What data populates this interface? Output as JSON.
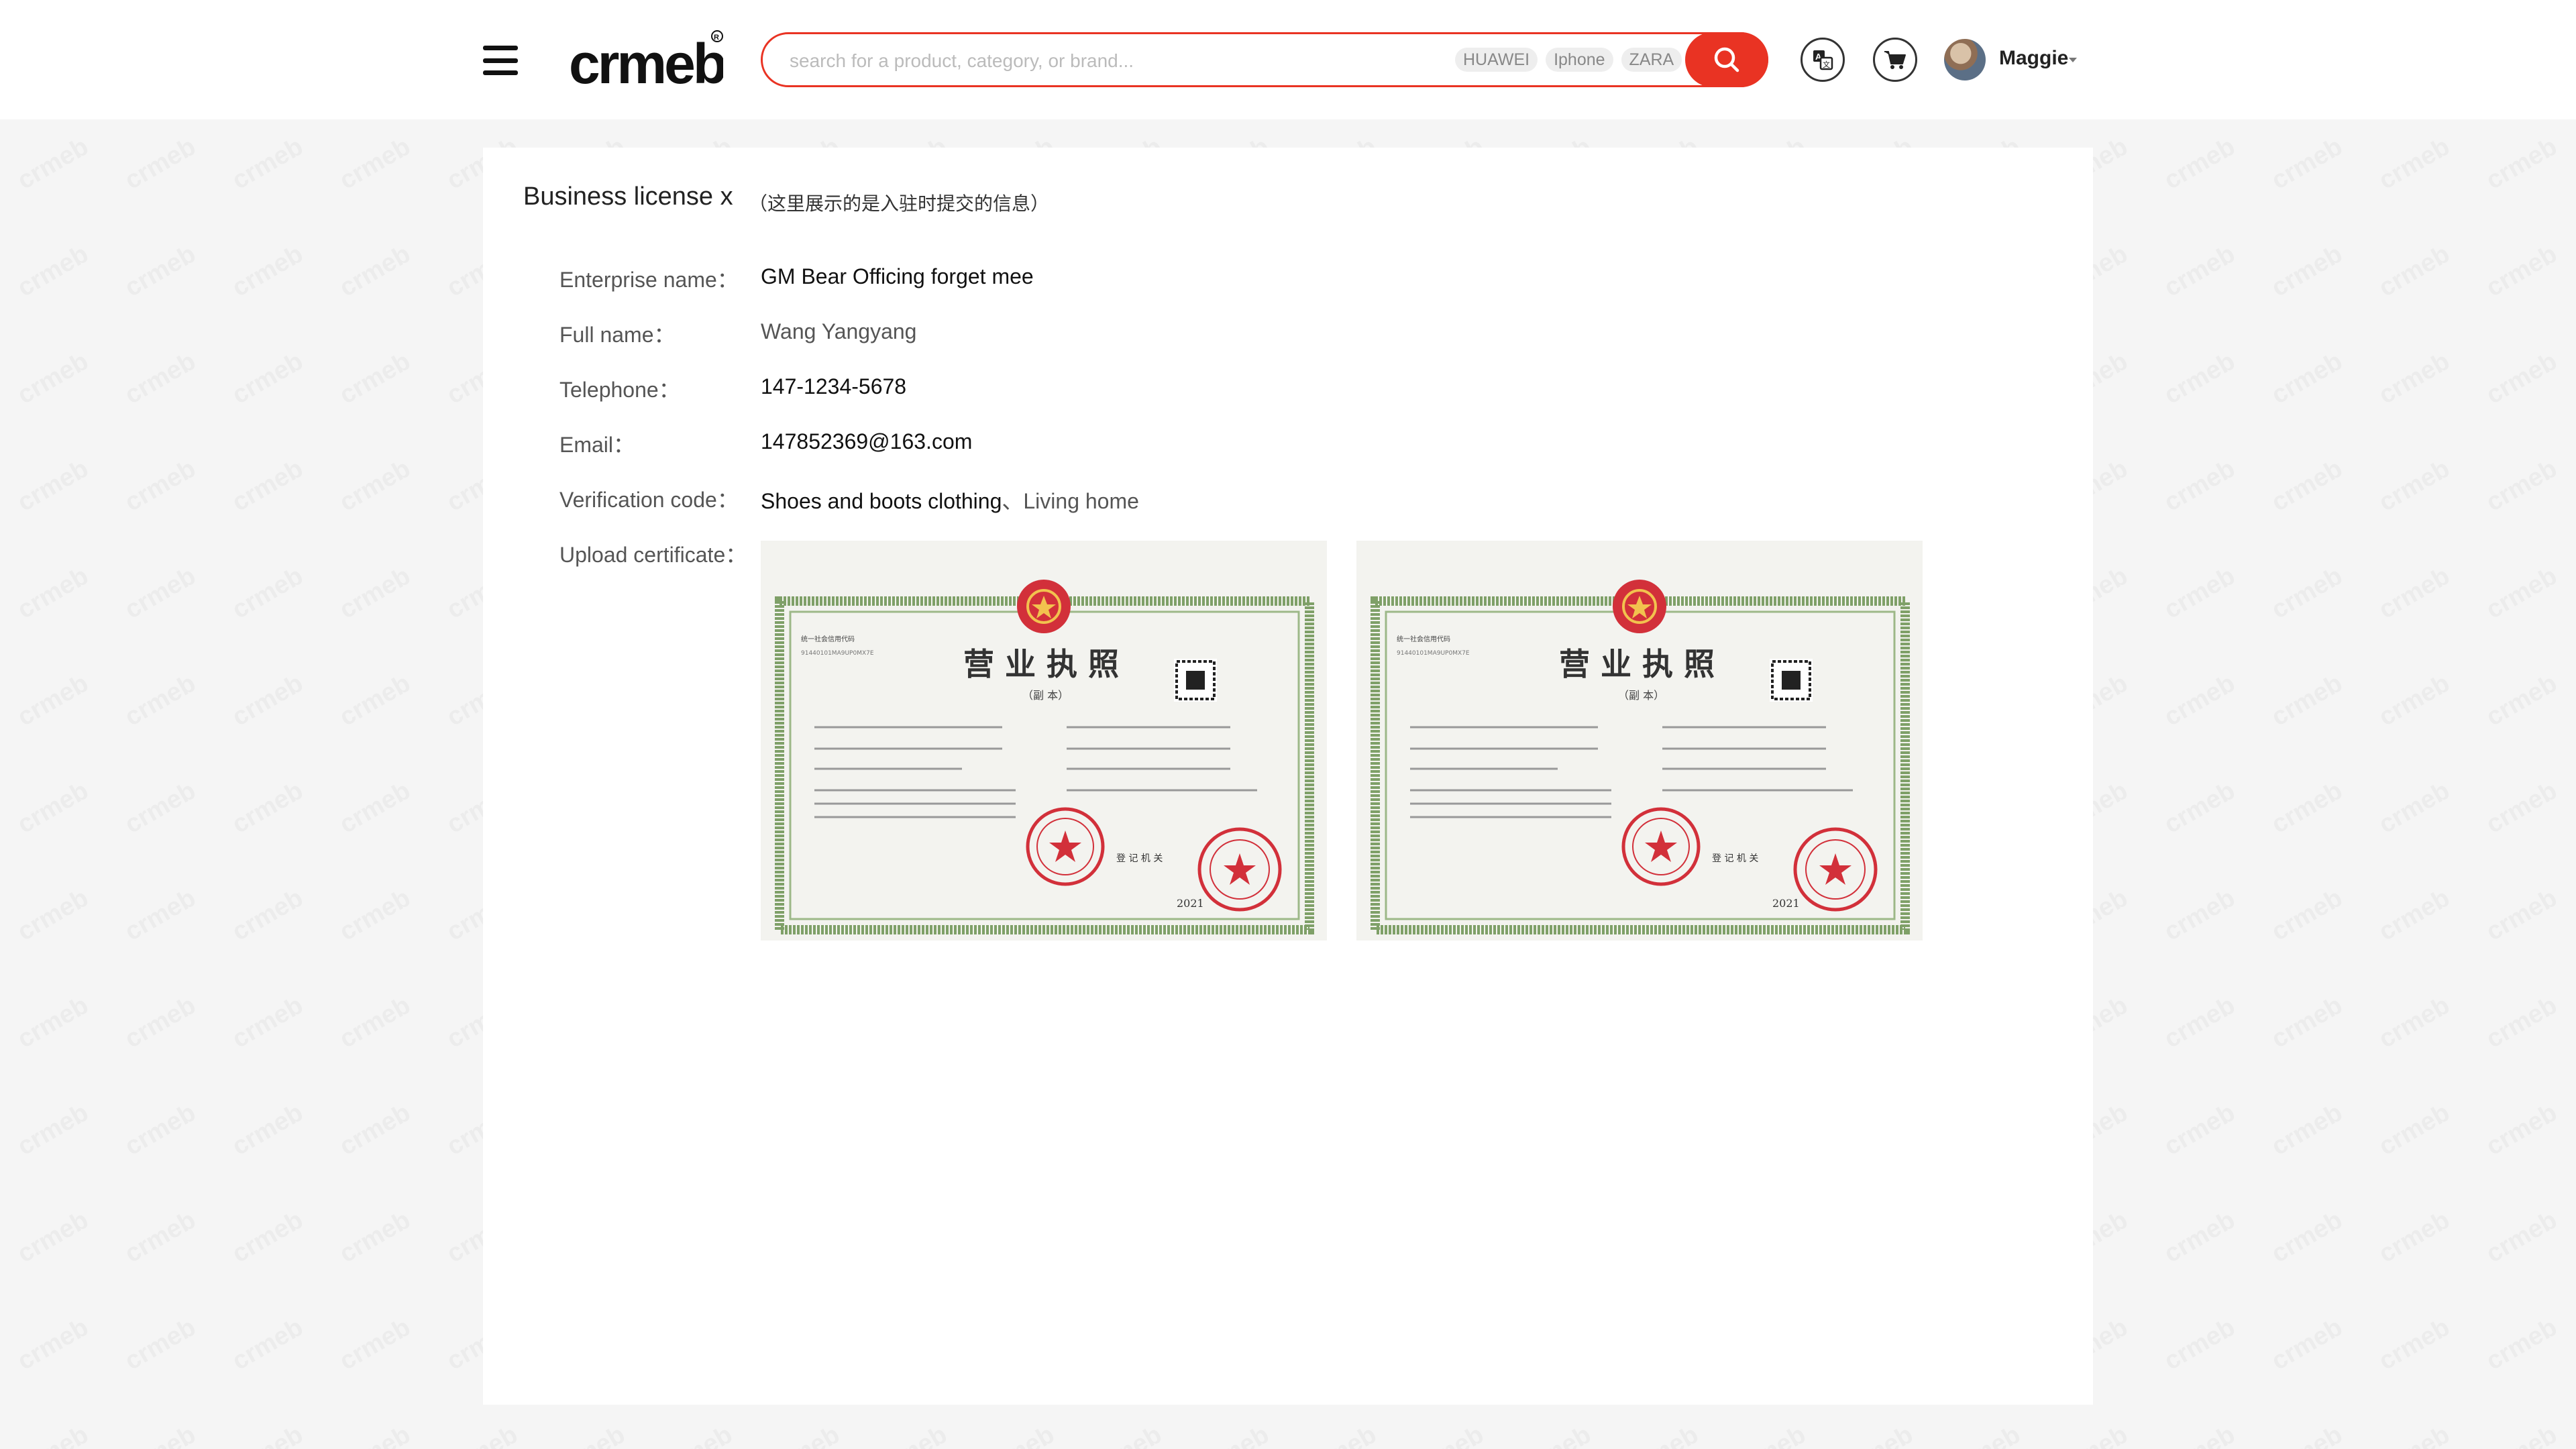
{
  "header": {
    "search_placeholder": "search for a product, category, or brand...",
    "hot_tags": [
      "HUAWEI",
      "Iphone",
      "ZARA"
    ],
    "user_name": "Maggie",
    "logo_text": "crmeb"
  },
  "page": {
    "title": "Business license x",
    "title_note": "（这里展示的是入驻时提交的信息）"
  },
  "fields": {
    "enterprise_label": "Enterprise name：",
    "enterprise_value": "GM Bear Officing forget mee",
    "fullname_label": "Full name：",
    "fullname_value": "Wang Yangyang",
    "telephone_label": "Telephone：",
    "telephone_value": "147-1234-5678",
    "email_label": "Email：",
    "email_value": "147852369@163.com",
    "verification_label": "Verification code：",
    "verification_value_1": "Shoes and boots clothing",
    "verification_value_2": "、Living home",
    "upload_label": "Upload certificate："
  },
  "certificate": {
    "heading": "营 业 执 照",
    "sub": "（副 本）"
  },
  "colors": {
    "accent": "#e93323",
    "cert_border": "#7fa068",
    "seal": "#d2303a"
  }
}
